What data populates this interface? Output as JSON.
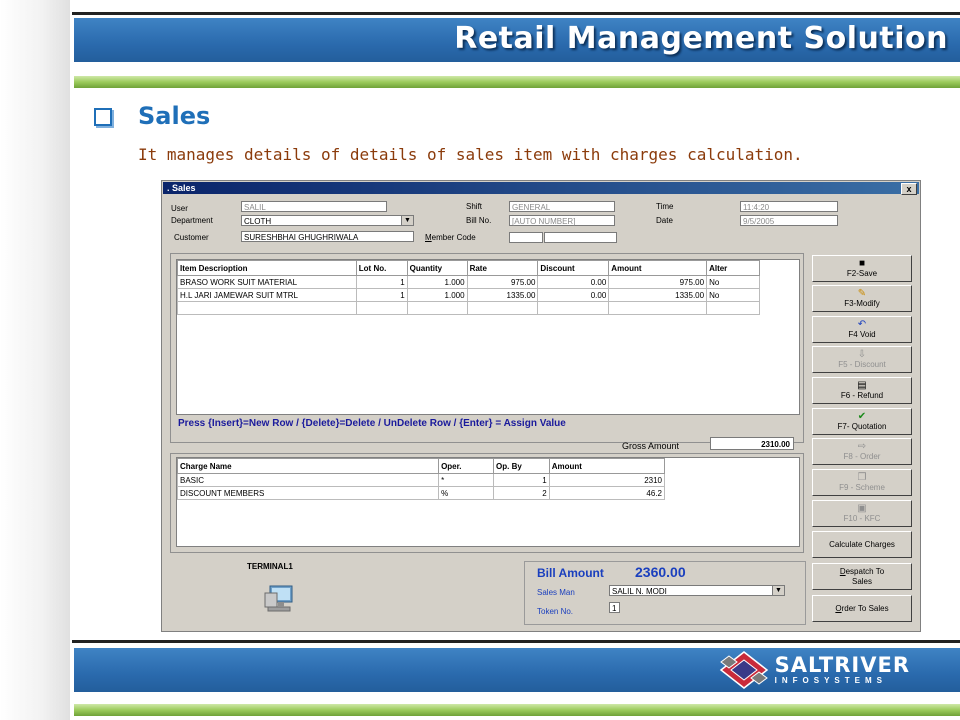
{
  "banner": {
    "title": "Retail Management Solution"
  },
  "section": {
    "heading": "Sales",
    "description": "It manages details of details of sales item with charges calculation."
  },
  "window": {
    "title": ". Sales",
    "close_label": "x",
    "header": {
      "user_label": "User",
      "user_value": "SALIL",
      "shift_label": "Shift",
      "shift_value": "GENERAL",
      "time_label": "Time",
      "time_value": "11:4:20",
      "department_label": "Department",
      "department_value": "CLOTH",
      "billno_label": "Bill No.",
      "billno_value": "[AUTO NUMBER]",
      "date_label": "Date",
      "date_value": "9/5/2005",
      "customer_label": "Customer",
      "customer_value": "SURESHBHAI GHUGHRIWALA",
      "membercode_label_first": "M",
      "membercode_label_rest": "ember Code"
    },
    "items": {
      "columns": [
        "Item Descrioption",
        "Lot No.",
        "Quantity",
        "Rate",
        "Discount",
        "Amount",
        "Alter"
      ],
      "rows": [
        [
          "BRASO WORK SUIT MATERIAL",
          "1",
          "1.000",
          "975.00",
          "0.00",
          "975.00",
          "No"
        ],
        [
          "H.L JARI JAMEWAR SUIT MTRL",
          "1",
          "1.000",
          "1335.00",
          "0.00",
          "1335.00",
          "No"
        ]
      ]
    },
    "hint": "Press {Insert}=New Row / {Delete}=Delete / UnDelete Row / {Enter} = Assign Value",
    "gross_amount_label": "Gross Amount",
    "gross_amount_value": "2310.00",
    "charges": {
      "columns": [
        "Charge Name",
        "Oper.",
        "Op. By",
        "Amount"
      ],
      "rows": [
        [
          "BASIC",
          "*",
          "1",
          "2310"
        ],
        [
          "DISCOUNT MEMBERS",
          "%",
          "2",
          "46.2"
        ]
      ]
    },
    "terminal": "TERMINAL1",
    "bill_amount_label": "Bill Amount",
    "bill_amount_value": "2360.00",
    "salesman_label": "Sales Man",
    "salesman_value": "SALIL N. MODI",
    "token_label": "Token No.",
    "token_value": "1",
    "buttons": {
      "save": "F2-Save",
      "modify": "F3-Modify",
      "void": "F4 Void",
      "discount": "F5 - Discount",
      "refund": "F6 - Refund",
      "quotation": "F7- Quotation",
      "order": "F8 - Order",
      "scheme": "F9 - Scheme",
      "kfc": "F10 - KFC",
      "calculate": "Calculate Charges",
      "despatch_first": "D",
      "despatch_rest": "espatch To",
      "despatch_line2": "Sales",
      "order_sales_first": "O",
      "order_sales_rest": "rder To Sales"
    }
  },
  "logo": {
    "main": "SALTRIVER",
    "sub": "INFOSYSTEMS"
  }
}
